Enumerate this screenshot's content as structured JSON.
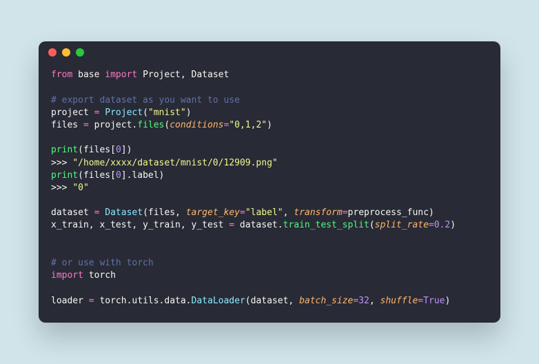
{
  "titlebar": {
    "dots": [
      "close",
      "minimize",
      "maximize"
    ]
  },
  "code": {
    "l1_from": "from",
    "l1_base": " base ",
    "l1_import": "import",
    "l1_rest": " Project, Dataset",
    "l2": "",
    "l3": "# export dataset as you want to use",
    "l4_a": "project ",
    "l4_eq": "=",
    "l4_b": " ",
    "l4_cls": "Project",
    "l4_c": "(",
    "l4_str": "\"mnist\"",
    "l4_d": ")",
    "l5_a": "files ",
    "l5_eq": "=",
    "l5_b": " project.",
    "l5_fn": "files",
    "l5_c": "(",
    "l5_param": "conditions",
    "l5_eq2": "=",
    "l5_str": "\"0,1,2\"",
    "l5_d": ")",
    "l6": "",
    "l7_fn": "print",
    "l7_a": "(files[",
    "l7_num": "0",
    "l7_b": "])",
    "l8_a": ">>> ",
    "l8_str": "\"/home/xxxx/dataset/mnist/0/12909.png\"",
    "l9_fn": "print",
    "l9_a": "(files[",
    "l9_num": "0",
    "l9_b": "].label)",
    "l10_a": ">>> ",
    "l10_str": "\"0\"",
    "l11": "",
    "l12_a": "dataset ",
    "l12_eq": "=",
    "l12_b": " ",
    "l12_cls": "Dataset",
    "l12_c": "(files, ",
    "l12_p1": "target_key",
    "l12_eq2": "=",
    "l12_str": "\"label\"",
    "l12_d": ", ",
    "l12_p2": "transform",
    "l12_eq3": "=",
    "l12_e": "preprocess_func)",
    "l13_a": "x_train, x_test, y_train, y_test ",
    "l13_eq": "=",
    "l13_b": " dataset.",
    "l13_fn": "train_test_split",
    "l13_c": "(",
    "l13_p1": "split_rate",
    "l13_eq2": "=",
    "l13_num": "0.2",
    "l13_d": ")",
    "l14": "",
    "l15": "",
    "l16": "# or use with torch",
    "l17_import": "import",
    "l17_a": " torch",
    "l18": "",
    "l19_a": "loader ",
    "l19_eq": "=",
    "l19_b": " torch.utils.data.",
    "l19_cls": "DataLoader",
    "l19_c": "(dataset, ",
    "l19_p1": "batch_size",
    "l19_eq2": "=",
    "l19_num": "32",
    "l19_d": ", ",
    "l19_p2": "shuffle",
    "l19_eq3": "=",
    "l19_const": "True",
    "l19_e": ")"
  }
}
